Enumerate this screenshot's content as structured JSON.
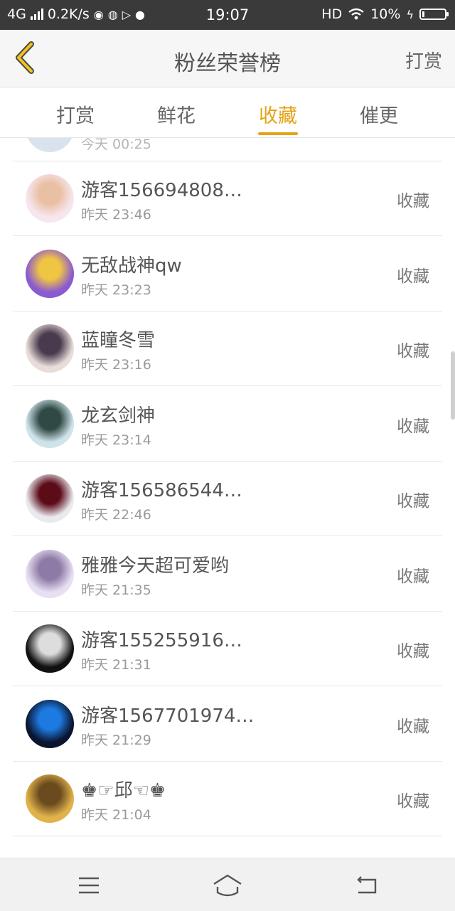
{
  "status_bar": {
    "network": "4G",
    "speed": "0.2K/s",
    "time": "19:07",
    "hd": "HD",
    "battery": "10%",
    "battery_level": 0.1
  },
  "header": {
    "title": "粉丝荣誉榜",
    "action": "打赏",
    "back_icon": "chevron-left-icon"
  },
  "tabs": [
    {
      "label": "打赏",
      "active": false
    },
    {
      "label": "鲜花",
      "active": false
    },
    {
      "label": "收藏",
      "active": true
    },
    {
      "label": "催更",
      "active": false
    }
  ],
  "colors": {
    "accent": "#e4a317",
    "status_bar_bg": "#3a3a3a",
    "header_bg": "#f6f6f6"
  },
  "list": {
    "partial_top_time": "今天 00:25",
    "items": [
      {
        "name": "游客156694808…",
        "time": "昨天 23:46",
        "type": "收藏",
        "avatar_colors": [
          "#f7e6ef",
          "#e9c0a4"
        ]
      },
      {
        "name": "无敌战神qw",
        "time": "昨天 23:23",
        "type": "收藏",
        "avatar_colors": [
          "#8a5ad1",
          "#f0c542"
        ]
      },
      {
        "name": "蓝瞳冬雪",
        "time": "昨天 23:16",
        "type": "收藏",
        "avatar_colors": [
          "#e8ddd8",
          "#4a3a4e"
        ]
      },
      {
        "name": "龙玄剑神",
        "time": "昨天 23:14",
        "type": "收藏",
        "avatar_colors": [
          "#cfe3ea",
          "#2f4a44"
        ]
      },
      {
        "name": "游客156586544…",
        "time": "昨天 22:46",
        "type": "收藏",
        "avatar_colors": [
          "#e9e9ee",
          "#5c0c18"
        ]
      },
      {
        "name": "雅雅今天超可爱哟",
        "time": "昨天 21:35",
        "type": "收藏",
        "avatar_colors": [
          "#e7dff2",
          "#8e7aa6"
        ]
      },
      {
        "name": "游客155255916…",
        "time": "昨天 21:31",
        "type": "收藏",
        "avatar_colors": [
          "#111111",
          "#dddddd"
        ]
      },
      {
        "name": "游客1567701974…",
        "time": "昨天 21:29",
        "type": "收藏",
        "avatar_colors": [
          "#0b1530",
          "#1d7ae0"
        ]
      },
      {
        "name": "♚☞邱☜♚",
        "time": "昨天 21:04",
        "type": "收藏",
        "avatar_colors": [
          "#e0b24a",
          "#6a4a1e"
        ]
      }
    ]
  },
  "nav": {
    "menu_icon": "menu-icon",
    "home_icon": "home-icon",
    "back_icon": "back-icon"
  }
}
